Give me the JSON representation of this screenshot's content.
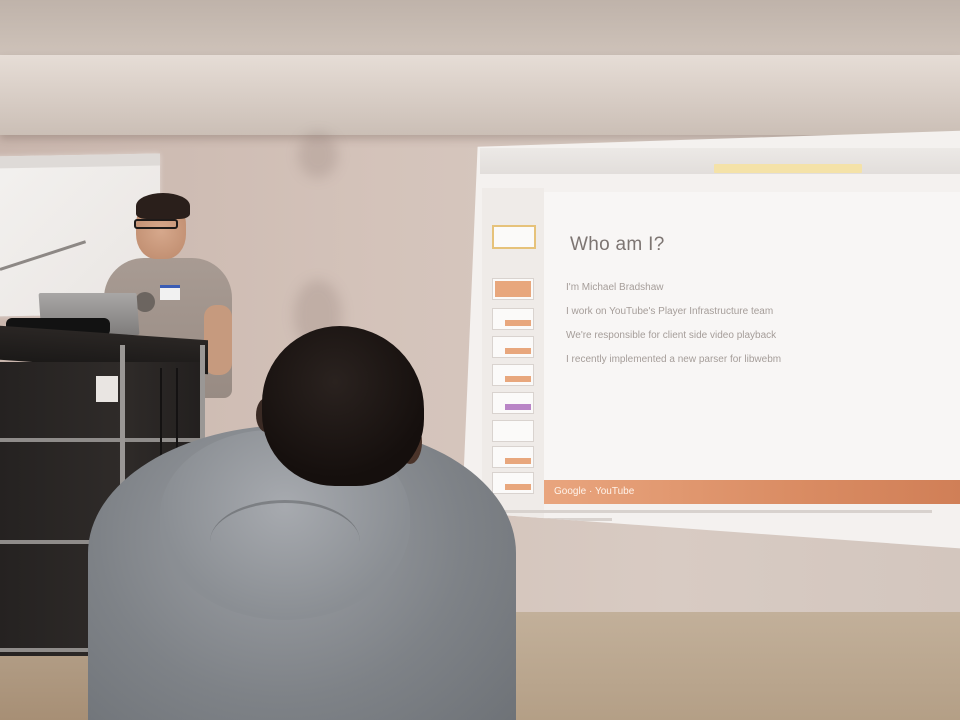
{
  "scene": {
    "description_type": "photo",
    "slide": {
      "title": "Who am I?",
      "bullets": [
        "I'm Michael Bradshaw",
        "I work on YouTube's Player Infrastructure team",
        "We're responsible for client side video playback",
        "I recently implemented a new parser for libwebm"
      ],
      "footer_logo": "Google · YouTube"
    },
    "colors": {
      "slide_accent": "#d98b62",
      "wall": "#d4c3ba",
      "hoodie": "#8a8e93"
    }
  }
}
